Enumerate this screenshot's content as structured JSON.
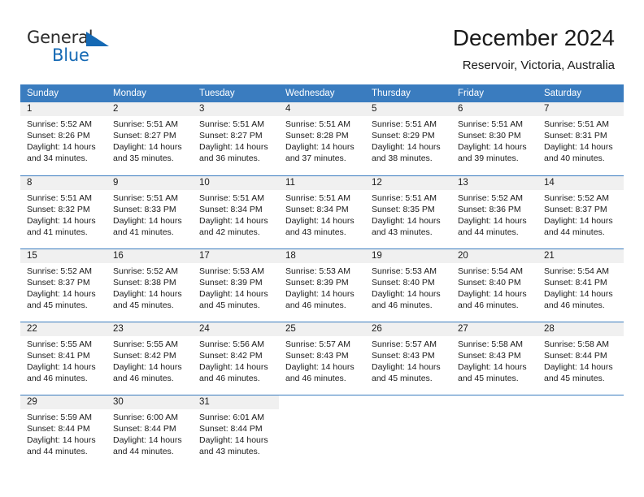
{
  "brand": {
    "line1": "General",
    "line2": "Blue",
    "triangle_color": "#1569b4",
    "icon": "triangle-logo-icon"
  },
  "header": {
    "title": "December 2024",
    "subtitle": "Reservoir, Victoria, Australia"
  },
  "theme": {
    "header_row_bg": "#3a7cbf",
    "daynum_bg": "#f0f0f0",
    "text": "#1a1a1a",
    "accent": "#1569b4"
  },
  "weekday_headers": [
    "Sunday",
    "Monday",
    "Tuesday",
    "Wednesday",
    "Thursday",
    "Friday",
    "Saturday"
  ],
  "weeks": [
    [
      {
        "day": "1",
        "sunrise": "Sunrise: 5:52 AM",
        "sunset": "Sunset: 8:26 PM",
        "daylight1": "Daylight: 14 hours",
        "daylight2": "and 34 minutes."
      },
      {
        "day": "2",
        "sunrise": "Sunrise: 5:51 AM",
        "sunset": "Sunset: 8:27 PM",
        "daylight1": "Daylight: 14 hours",
        "daylight2": "and 35 minutes."
      },
      {
        "day": "3",
        "sunrise": "Sunrise: 5:51 AM",
        "sunset": "Sunset: 8:27 PM",
        "daylight1": "Daylight: 14 hours",
        "daylight2": "and 36 minutes."
      },
      {
        "day": "4",
        "sunrise": "Sunrise: 5:51 AM",
        "sunset": "Sunset: 8:28 PM",
        "daylight1": "Daylight: 14 hours",
        "daylight2": "and 37 minutes."
      },
      {
        "day": "5",
        "sunrise": "Sunrise: 5:51 AM",
        "sunset": "Sunset: 8:29 PM",
        "daylight1": "Daylight: 14 hours",
        "daylight2": "and 38 minutes."
      },
      {
        "day": "6",
        "sunrise": "Sunrise: 5:51 AM",
        "sunset": "Sunset: 8:30 PM",
        "daylight1": "Daylight: 14 hours",
        "daylight2": "and 39 minutes."
      },
      {
        "day": "7",
        "sunrise": "Sunrise: 5:51 AM",
        "sunset": "Sunset: 8:31 PM",
        "daylight1": "Daylight: 14 hours",
        "daylight2": "and 40 minutes."
      }
    ],
    [
      {
        "day": "8",
        "sunrise": "Sunrise: 5:51 AM",
        "sunset": "Sunset: 8:32 PM",
        "daylight1": "Daylight: 14 hours",
        "daylight2": "and 41 minutes."
      },
      {
        "day": "9",
        "sunrise": "Sunrise: 5:51 AM",
        "sunset": "Sunset: 8:33 PM",
        "daylight1": "Daylight: 14 hours",
        "daylight2": "and 41 minutes."
      },
      {
        "day": "10",
        "sunrise": "Sunrise: 5:51 AM",
        "sunset": "Sunset: 8:34 PM",
        "daylight1": "Daylight: 14 hours",
        "daylight2": "and 42 minutes."
      },
      {
        "day": "11",
        "sunrise": "Sunrise: 5:51 AM",
        "sunset": "Sunset: 8:34 PM",
        "daylight1": "Daylight: 14 hours",
        "daylight2": "and 43 minutes."
      },
      {
        "day": "12",
        "sunrise": "Sunrise: 5:51 AM",
        "sunset": "Sunset: 8:35 PM",
        "daylight1": "Daylight: 14 hours",
        "daylight2": "and 43 minutes."
      },
      {
        "day": "13",
        "sunrise": "Sunrise: 5:52 AM",
        "sunset": "Sunset: 8:36 PM",
        "daylight1": "Daylight: 14 hours",
        "daylight2": "and 44 minutes."
      },
      {
        "day": "14",
        "sunrise": "Sunrise: 5:52 AM",
        "sunset": "Sunset: 8:37 PM",
        "daylight1": "Daylight: 14 hours",
        "daylight2": "and 44 minutes."
      }
    ],
    [
      {
        "day": "15",
        "sunrise": "Sunrise: 5:52 AM",
        "sunset": "Sunset: 8:37 PM",
        "daylight1": "Daylight: 14 hours",
        "daylight2": "and 45 minutes."
      },
      {
        "day": "16",
        "sunrise": "Sunrise: 5:52 AM",
        "sunset": "Sunset: 8:38 PM",
        "daylight1": "Daylight: 14 hours",
        "daylight2": "and 45 minutes."
      },
      {
        "day": "17",
        "sunrise": "Sunrise: 5:53 AM",
        "sunset": "Sunset: 8:39 PM",
        "daylight1": "Daylight: 14 hours",
        "daylight2": "and 45 minutes."
      },
      {
        "day": "18",
        "sunrise": "Sunrise: 5:53 AM",
        "sunset": "Sunset: 8:39 PM",
        "daylight1": "Daylight: 14 hours",
        "daylight2": "and 46 minutes."
      },
      {
        "day": "19",
        "sunrise": "Sunrise: 5:53 AM",
        "sunset": "Sunset: 8:40 PM",
        "daylight1": "Daylight: 14 hours",
        "daylight2": "and 46 minutes."
      },
      {
        "day": "20",
        "sunrise": "Sunrise: 5:54 AM",
        "sunset": "Sunset: 8:40 PM",
        "daylight1": "Daylight: 14 hours",
        "daylight2": "and 46 minutes."
      },
      {
        "day": "21",
        "sunrise": "Sunrise: 5:54 AM",
        "sunset": "Sunset: 8:41 PM",
        "daylight1": "Daylight: 14 hours",
        "daylight2": "and 46 minutes."
      }
    ],
    [
      {
        "day": "22",
        "sunrise": "Sunrise: 5:55 AM",
        "sunset": "Sunset: 8:41 PM",
        "daylight1": "Daylight: 14 hours",
        "daylight2": "and 46 minutes."
      },
      {
        "day": "23",
        "sunrise": "Sunrise: 5:55 AM",
        "sunset": "Sunset: 8:42 PM",
        "daylight1": "Daylight: 14 hours",
        "daylight2": "and 46 minutes."
      },
      {
        "day": "24",
        "sunrise": "Sunrise: 5:56 AM",
        "sunset": "Sunset: 8:42 PM",
        "daylight1": "Daylight: 14 hours",
        "daylight2": "and 46 minutes."
      },
      {
        "day": "25",
        "sunrise": "Sunrise: 5:57 AM",
        "sunset": "Sunset: 8:43 PM",
        "daylight1": "Daylight: 14 hours",
        "daylight2": "and 46 minutes."
      },
      {
        "day": "26",
        "sunrise": "Sunrise: 5:57 AM",
        "sunset": "Sunset: 8:43 PM",
        "daylight1": "Daylight: 14 hours",
        "daylight2": "and 45 minutes."
      },
      {
        "day": "27",
        "sunrise": "Sunrise: 5:58 AM",
        "sunset": "Sunset: 8:43 PM",
        "daylight1": "Daylight: 14 hours",
        "daylight2": "and 45 minutes."
      },
      {
        "day": "28",
        "sunrise": "Sunrise: 5:58 AM",
        "sunset": "Sunset: 8:44 PM",
        "daylight1": "Daylight: 14 hours",
        "daylight2": "and 45 minutes."
      }
    ],
    [
      {
        "day": "29",
        "sunrise": "Sunrise: 5:59 AM",
        "sunset": "Sunset: 8:44 PM",
        "daylight1": "Daylight: 14 hours",
        "daylight2": "and 44 minutes."
      },
      {
        "day": "30",
        "sunrise": "Sunrise: 6:00 AM",
        "sunset": "Sunset: 8:44 PM",
        "daylight1": "Daylight: 14 hours",
        "daylight2": "and 44 minutes."
      },
      {
        "day": "31",
        "sunrise": "Sunrise: 6:01 AM",
        "sunset": "Sunset: 8:44 PM",
        "daylight1": "Daylight: 14 hours",
        "daylight2": "and 43 minutes."
      },
      {
        "day": "",
        "sunrise": "",
        "sunset": "",
        "daylight1": "",
        "daylight2": ""
      },
      {
        "day": "",
        "sunrise": "",
        "sunset": "",
        "daylight1": "",
        "daylight2": ""
      },
      {
        "day": "",
        "sunrise": "",
        "sunset": "",
        "daylight1": "",
        "daylight2": ""
      },
      {
        "day": "",
        "sunrise": "",
        "sunset": "",
        "daylight1": "",
        "daylight2": ""
      }
    ]
  ]
}
